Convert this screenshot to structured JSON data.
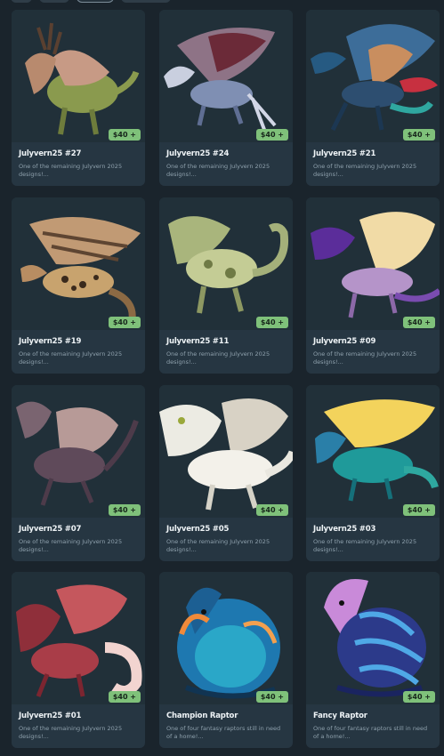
{
  "tabs": [
    "",
    "",
    "",
    ""
  ],
  "listings": [
    {
      "title": "Julyvern25 #27",
      "description": "One of the remaining Julyvern 2025 designs!...",
      "price": "$40 +",
      "art": "olive-dragon-with-antlers"
    },
    {
      "title": "Julyvern25 #24",
      "description": "One of the remaining Julyvern 2025 designs!...",
      "price": "$40 +",
      "art": "slate-blue-winged-dragon"
    },
    {
      "title": "Julyvern25 #21",
      "description": "One of the remaining Julyvern 2025 designs!...",
      "price": "$40 +",
      "art": "teal-and-red-feathered-dragon"
    },
    {
      "title": "Julyvern25 #19",
      "description": "One of the remaining Julyvern 2025 designs!...",
      "price": "$40 +",
      "art": "leopard-spotted-dragon"
    },
    {
      "title": "Julyvern25 #11",
      "description": "One of the remaining Julyvern 2025 designs!...",
      "price": "$40 +",
      "art": "sage-camo-dragon"
    },
    {
      "title": "Julyvern25 #09",
      "description": "One of the remaining Julyvern 2025 designs!...",
      "price": "$40 +",
      "art": "purple-cream-dragon"
    },
    {
      "title": "Julyvern25 #07",
      "description": "One of the remaining Julyvern 2025 designs!...",
      "price": "$40 +",
      "art": "dusky-mauve-dragon"
    },
    {
      "title": "Julyvern25 #05",
      "description": "One of the remaining Julyvern 2025 designs!...",
      "price": "$40 +",
      "art": "white-fluffy-dragon"
    },
    {
      "title": "Julyvern25 #03",
      "description": "One of the remaining Julyvern 2025 designs!...",
      "price": "$40 +",
      "art": "teal-yellow-winged-dragon"
    },
    {
      "title": "Julyvern25 #01",
      "description": "One of the remaining Julyvern 2025 designs!...",
      "price": "$40 +",
      "art": "crimson-maned-dragon"
    },
    {
      "title": "Champion Raptor",
      "description": "One of four fantasy raptors still in need of a home!...",
      "price": "$40 +",
      "art": "blue-orange-raptor"
    },
    {
      "title": "Fancy Raptor",
      "description": "One of four fantasy raptors still in need of a home!...",
      "price": "$40 +",
      "art": "violet-striped-raptor"
    }
  ],
  "colors": {
    "background": "#1a242c",
    "card": "#263642",
    "price_badge": "#7fc17a"
  }
}
